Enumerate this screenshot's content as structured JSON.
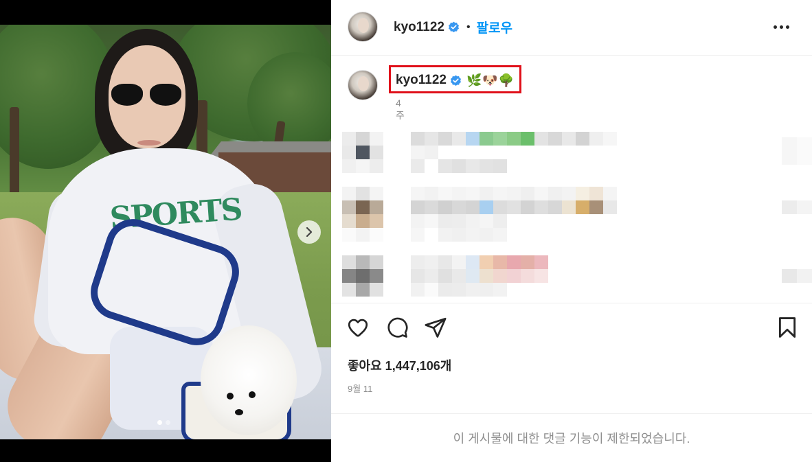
{
  "post": {
    "username": "kyo1122",
    "follow_label": "팔로우",
    "separator": "•",
    "caption_emojis": "🌿🐶🌳",
    "time_ago": "4주",
    "likes_text": "좋아요 1,447,106개",
    "date": "9월 11",
    "comments_disabled": "이 게시물에 대한 댓글 기능이 제한되었습니다."
  },
  "carousel": {
    "total_slides": 2,
    "current_slide": 1
  },
  "photo_text": {
    "sweatshirt_logo": "SPORTS"
  },
  "icons": {
    "verified": "verified-badge-icon",
    "more": "more-options-icon",
    "like": "heart-icon",
    "comment": "comment-bubble-icon",
    "share": "paper-plane-icon",
    "save": "bookmark-icon",
    "next": "chevron-right-icon"
  },
  "colors": {
    "link_blue": "#0095f6",
    "verified_blue": "#3897f0",
    "highlight_red": "#e0101a",
    "text_primary": "#262626",
    "text_secondary": "#8e8e8e"
  }
}
